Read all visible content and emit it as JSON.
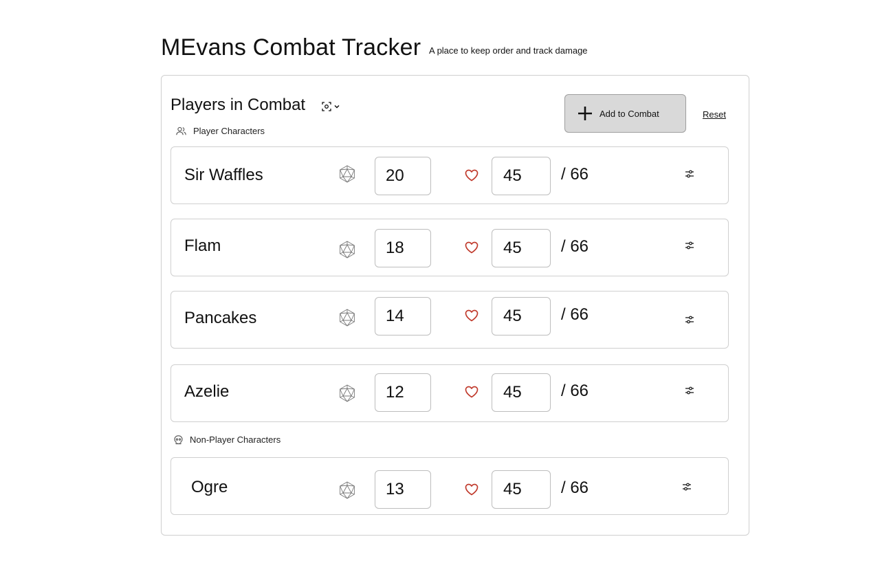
{
  "header": {
    "title": "MEvans Combat Tracker",
    "subtitle": "A place to keep order and track damage"
  },
  "panel": {
    "title": "Players in Combat",
    "view_toggle_icon": "scan-icon",
    "add_button_label": "Add to Combat",
    "reset_label": "Reset"
  },
  "sections": {
    "pc_label": "Player Characters",
    "npc_label": "Non-Player Characters"
  },
  "players": [
    {
      "name": "Sir Waffles",
      "initiative": "20",
      "hp": "45",
      "max_hp": "/ 66"
    },
    {
      "name": "Flam",
      "initiative": "18",
      "hp": "45",
      "max_hp": "/ 66"
    },
    {
      "name": "Pancakes",
      "initiative": "14",
      "hp": "45",
      "max_hp": "/ 66"
    },
    {
      "name": "Azelie",
      "initiative": "12",
      "hp": "45",
      "max_hp": "/ 66"
    }
  ],
  "npcs": [
    {
      "name": "Ogre",
      "initiative": "13",
      "hp": "45",
      "max_hp": "/ 66"
    }
  ],
  "colors": {
    "heart": "#c0392b",
    "button_bg": "#d9d9d9",
    "border": "#cfcfcf"
  },
  "icons": {
    "initiative": "d20-icon",
    "health": "heart-icon",
    "settings": "sliders-icon",
    "player_characters": "users-icon",
    "npc": "skull-icon",
    "add": "plus-icon"
  }
}
